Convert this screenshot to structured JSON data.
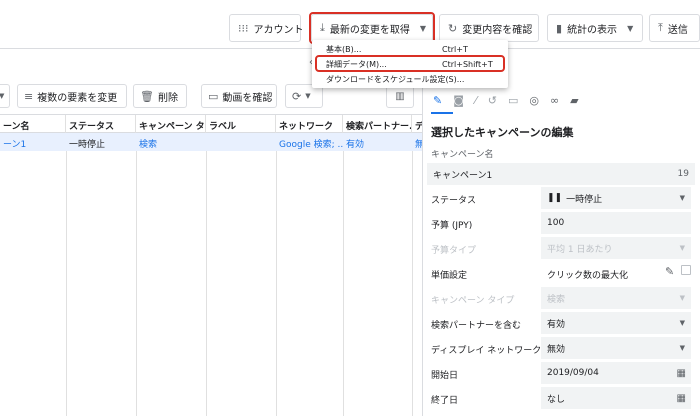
{
  "toolbar": {
    "account_label": "アカウント",
    "get_changes_label": "最新の変更を取得",
    "check_changes_label": "変更内容を確認",
    "stats_label": "統計の表示",
    "send_label": "送信"
  },
  "menu": {
    "items": [
      {
        "label": "基本(B)...",
        "shortcut": "Ctrl+T"
      },
      {
        "label": "詳細データ(M)...",
        "shortcut": "Ctrl+Shift+T"
      },
      {
        "label": "ダウンロードをスケジュール設定(S)...",
        "shortcut": ""
      }
    ]
  },
  "gridbar": {
    "bulk_change_label": "複数の要素を変更",
    "delete_label": "削除",
    "video_label": "動画を確認"
  },
  "table": {
    "columns": [
      "ーン名",
      "ステータス",
      "キャンペーン タイプ",
      "ラベル",
      "ネットワーク",
      "検索パートナー...",
      "デ"
    ],
    "rows": [
      {
        "name": "ーン1",
        "status": "一時停止",
        "type": "検索",
        "label": "",
        "network": "Google 検索; ...",
        "partner": "有効",
        "d": "無"
      }
    ]
  },
  "panel": {
    "title": "選択したキャンペーンの編集",
    "campaign_name_label": "キャンペーン名",
    "campaign_name_value": "キャンペーン1",
    "campaign_name_count": "19",
    "status_label": "ステータス",
    "status_value": "一時停止",
    "budget_label": "予算 (JPY)",
    "budget_value": "100",
    "budget_type_label": "予算タイプ",
    "budget_type_value": "平均 1 日あたり",
    "bid_label": "単価設定",
    "bid_value": "クリック数の最大化",
    "campaign_type_label": "キャンペーン タイプ",
    "campaign_type_value": "検索",
    "search_partner_label": "検索パートナーを含む",
    "search_partner_value": "有効",
    "display_label": "ディスプレイ ネットワークを含める",
    "display_value": "無効",
    "start_label": "開始日",
    "start_value": "2019/09/04",
    "end_label": "終了日",
    "end_value": "なし"
  },
  "colors": {
    "accent": "#1a73e8",
    "highlight": "#d93025",
    "row_selected": "#e8f0fe"
  }
}
